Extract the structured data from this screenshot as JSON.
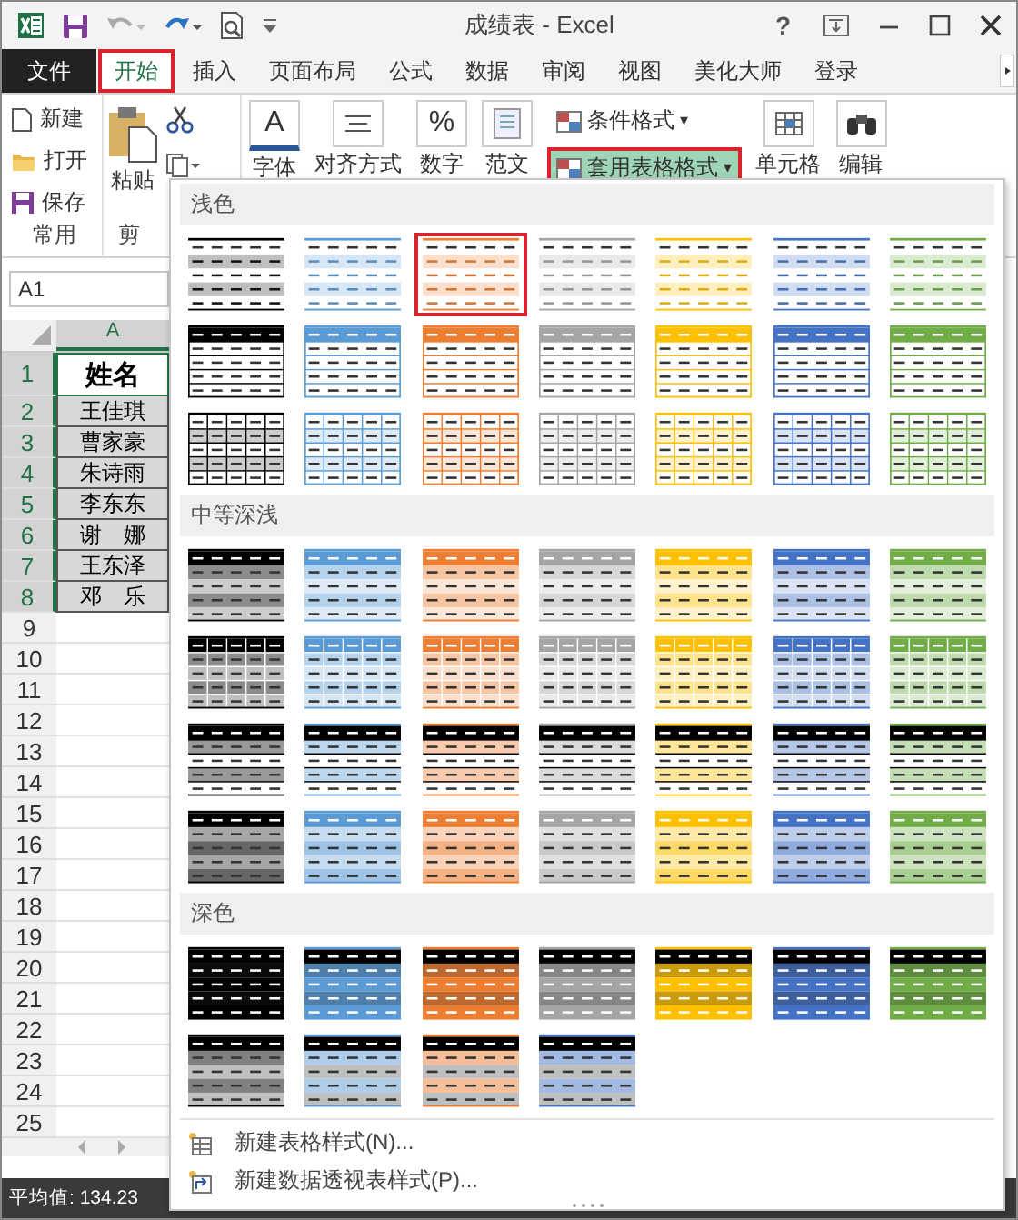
{
  "window": {
    "title": "成绩表 - Excel",
    "help": "?"
  },
  "ribbon_tabs": [
    {
      "label": "文件",
      "kind": "file",
      "selected": false
    },
    {
      "label": "开始",
      "kind": "tab",
      "selected": true
    },
    {
      "label": "插入",
      "kind": "tab",
      "selected": false
    },
    {
      "label": "页面布局",
      "kind": "tab",
      "selected": false
    },
    {
      "label": "公式",
      "kind": "tab",
      "selected": false
    },
    {
      "label": "数据",
      "kind": "tab",
      "selected": false
    },
    {
      "label": "审阅",
      "kind": "tab",
      "selected": false
    },
    {
      "label": "视图",
      "kind": "tab",
      "selected": false
    },
    {
      "label": "美化大师",
      "kind": "tab",
      "selected": false
    },
    {
      "label": "登录",
      "kind": "tab",
      "selected": false
    }
  ],
  "ribbon": {
    "common_buttons": [
      {
        "label": "新建"
      },
      {
        "label": "打开"
      },
      {
        "label": "保存"
      }
    ],
    "common_label": "常用",
    "paste_label": "粘贴",
    "clipboard_label": "剪",
    "large_buttons": [
      {
        "label": "字体",
        "icon_text": "A"
      },
      {
        "label": "对齐方式"
      },
      {
        "label": "数字",
        "icon_text": "%"
      },
      {
        "label": "范文"
      }
    ],
    "style_buttons": [
      {
        "label": "条件格式",
        "caret": "▾",
        "selected": false
      },
      {
        "label": "套用表格格式",
        "caret": "▾",
        "selected": true
      }
    ],
    "more_buttons": [
      {
        "label": "单元格"
      },
      {
        "label": "编辑"
      }
    ]
  },
  "sheet": {
    "name_box": "A1",
    "column": "A",
    "rows": [
      {
        "num": "1",
        "value": "姓名",
        "selected": true
      },
      {
        "num": "2",
        "value": "王佳琪",
        "selected": true
      },
      {
        "num": "3",
        "value": "曹家豪",
        "selected": true
      },
      {
        "num": "4",
        "value": "朱诗雨",
        "selected": true
      },
      {
        "num": "5",
        "value": "李东东",
        "selected": true
      },
      {
        "num": "6",
        "value": "谢　娜",
        "selected": true
      },
      {
        "num": "7",
        "value": "王东泽",
        "selected": true
      },
      {
        "num": "8",
        "value": "邓　乐",
        "selected": true
      },
      {
        "num": "9",
        "selected": false
      },
      {
        "num": "10",
        "selected": false
      },
      {
        "num": "11",
        "selected": false
      },
      {
        "num": "12",
        "selected": false
      },
      {
        "num": "13",
        "selected": false
      },
      {
        "num": "14",
        "selected": false
      },
      {
        "num": "15",
        "selected": false
      },
      {
        "num": "16",
        "selected": false
      },
      {
        "num": "17",
        "selected": false
      },
      {
        "num": "18",
        "selected": false
      },
      {
        "num": "19",
        "selected": false
      },
      {
        "num": "20",
        "selected": false
      },
      {
        "num": "21",
        "selected": false
      },
      {
        "num": "22",
        "selected": false
      },
      {
        "num": "23",
        "selected": false
      },
      {
        "num": "24",
        "selected": false
      },
      {
        "num": "25",
        "selected": false
      }
    ]
  },
  "gallery": {
    "sections": [
      {
        "title": "浅色",
        "rows": [
          {
            "kind": "light-banded",
            "swatches": [
              {
                "color": "#000000",
                "selected": false
              },
              {
                "color": "#5b9bd5",
                "selected": false
              },
              {
                "color": "#ed7d31",
                "selected": true
              },
              {
                "color": "#a5a5a5",
                "selected": false
              },
              {
                "color": "#ffc000",
                "selected": false
              },
              {
                "color": "#4472c4",
                "selected": false
              },
              {
                "color": "#70ad47",
                "selected": false
              }
            ]
          },
          {
            "kind": "light-header",
            "swatches": [
              {
                "color": "#000000",
                "selected": false
              },
              {
                "color": "#5b9bd5",
                "selected": false
              },
              {
                "color": "#ed7d31",
                "selected": false
              },
              {
                "color": "#a5a5a5",
                "selected": false
              },
              {
                "color": "#ffc000",
                "selected": false
              },
              {
                "color": "#4472c4",
                "selected": false
              },
              {
                "color": "#70ad47",
                "selected": false
              }
            ]
          },
          {
            "kind": "light-grid",
            "swatches": [
              {
                "color": "#000000",
                "selected": false
              },
              {
                "color": "#5b9bd5",
                "selected": false
              },
              {
                "color": "#ed7d31",
                "selected": false
              },
              {
                "color": "#a5a5a5",
                "selected": false
              },
              {
                "color": "#ffc000",
                "selected": false
              },
              {
                "color": "#4472c4",
                "selected": false
              },
              {
                "color": "#70ad47",
                "selected": false
              }
            ]
          }
        ]
      },
      {
        "title": "中等深浅",
        "rows": [
          {
            "kind": "medium-banded",
            "swatches": [
              {
                "color": "#000000",
                "selected": false
              },
              {
                "color": "#5b9bd5",
                "selected": false
              },
              {
                "color": "#ed7d31",
                "selected": false
              },
              {
                "color": "#a5a5a5",
                "selected": false
              },
              {
                "color": "#ffc000",
                "selected": false
              },
              {
                "color": "#4472c4",
                "selected": false
              },
              {
                "color": "#70ad47",
                "selected": false
              }
            ]
          },
          {
            "kind": "medium-grid",
            "swatches": [
              {
                "color": "#000000",
                "selected": false
              },
              {
                "color": "#5b9bd5",
                "selected": false
              },
              {
                "color": "#ed7d31",
                "selected": false
              },
              {
                "color": "#a5a5a5",
                "selected": false
              },
              {
                "color": "#ffc000",
                "selected": false
              },
              {
                "color": "#4472c4",
                "selected": false
              },
              {
                "color": "#70ad47",
                "selected": false
              }
            ]
          },
          {
            "kind": "medium-black-header",
            "swatches": [
              {
                "color": "#000000",
                "selected": false
              },
              {
                "color": "#5b9bd5",
                "selected": false
              },
              {
                "color": "#ed7d31",
                "selected": false
              },
              {
                "color": "#a5a5a5",
                "selected": false
              },
              {
                "color": "#ffc000",
                "selected": false
              },
              {
                "color": "#4472c4",
                "selected": false
              },
              {
                "color": "#70ad47",
                "selected": false
              }
            ]
          },
          {
            "kind": "medium-filled",
            "swatches": [
              {
                "color": "#000000",
                "selected": false
              },
              {
                "color": "#5b9bd5",
                "selected": false
              },
              {
                "color": "#ed7d31",
                "selected": false
              },
              {
                "color": "#a5a5a5",
                "selected": false
              },
              {
                "color": "#ffc000",
                "selected": false
              },
              {
                "color": "#4472c4",
                "selected": false
              },
              {
                "color": "#70ad47",
                "selected": false
              }
            ]
          }
        ]
      },
      {
        "title": "深色",
        "rows": [
          {
            "kind": "dark",
            "swatches": [
              {
                "color": "#000000",
                "selected": false
              },
              {
                "color": "#5b9bd5",
                "selected": false
              },
              {
                "color": "#ed7d31",
                "selected": false
              },
              {
                "color": "#a5a5a5",
                "selected": false
              },
              {
                "color": "#ffc000",
                "selected": false
              },
              {
                "color": "#4472c4",
                "selected": false
              },
              {
                "color": "#70ad47",
                "selected": false
              }
            ]
          },
          {
            "kind": "dark-banded",
            "swatches": [
              {
                "color": "#000000",
                "selected": false
              },
              {
                "color": "#5b9bd5",
                "selected": false
              },
              {
                "color": "#ed7d31",
                "selected": false
              },
              {
                "color": "#4472c4",
                "selected": false
              }
            ]
          }
        ]
      }
    ],
    "menu": [
      {
        "label": "新建表格样式(N)..."
      },
      {
        "label": "新建数据透视表样式(P)..."
      }
    ]
  },
  "status_bar": {
    "text": "平均值: 134.23"
  }
}
